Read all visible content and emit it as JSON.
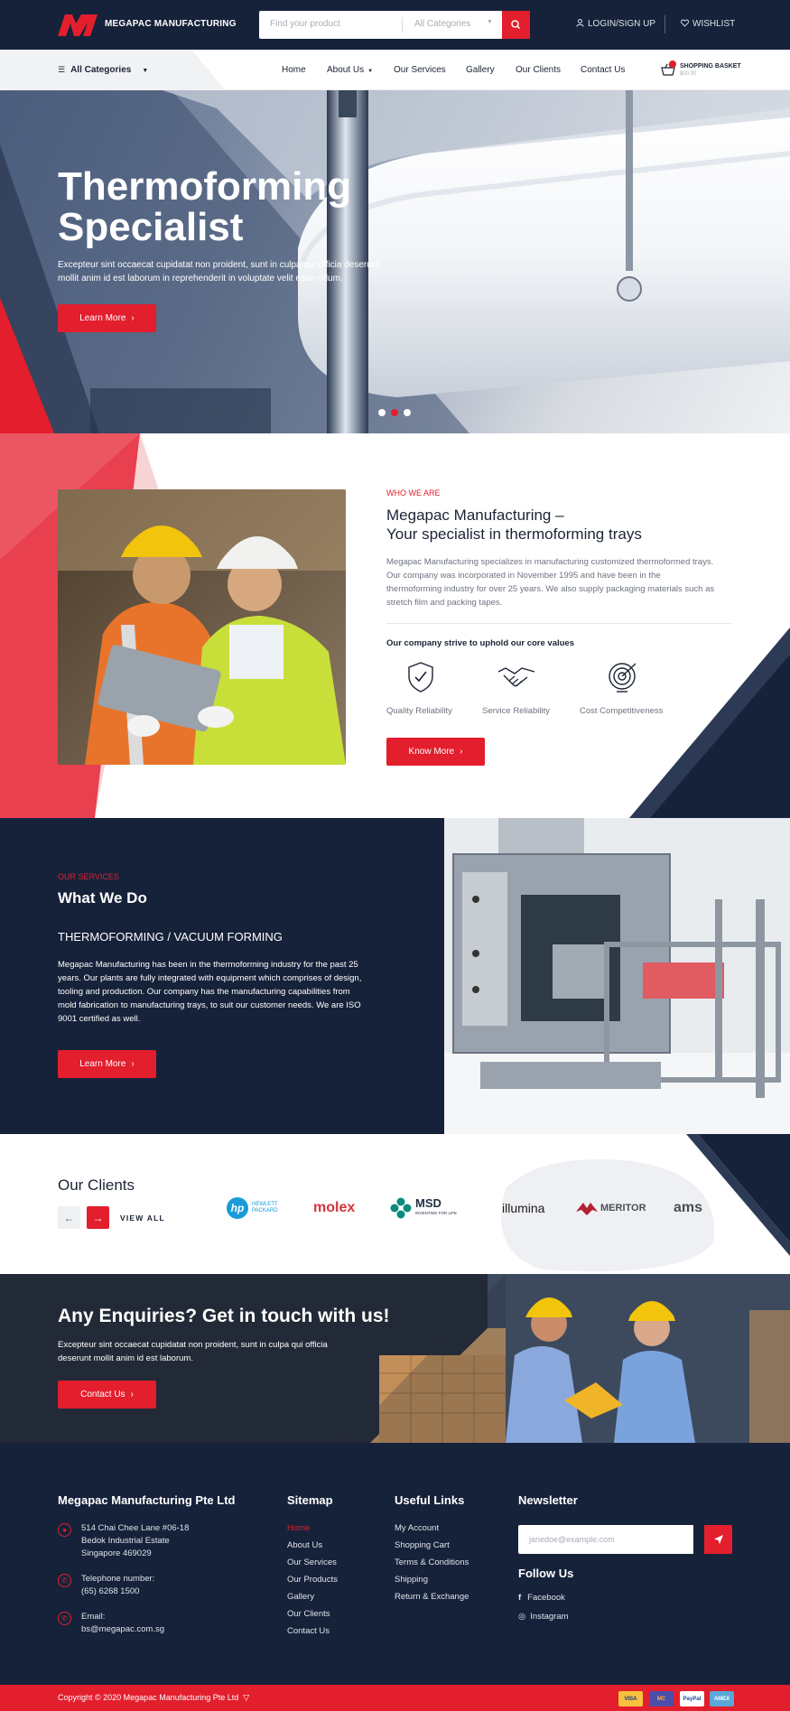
{
  "brand": {
    "name": "MEGAPAC MANUFACTURING"
  },
  "search": {
    "placeholder": "Find your product",
    "category": "All Categories"
  },
  "account": {
    "login": "LOGIN/SIGN UP",
    "wishlist": "WISHLIST"
  },
  "nav": {
    "all_categories": "All Categories",
    "items": [
      "Home",
      "About Us",
      "Our Services",
      "Gallery",
      "Our Clients",
      "Contact Us"
    ],
    "basket_title": "SHOPPING BASKET",
    "basket_amount": "$00.00"
  },
  "hero": {
    "title_line1": "Thermoforming",
    "title_line2": "Specialist",
    "text": "Excepteur sint occaecat cupidatat non proident, sunt in culpa qui officia deserunt mollit anim id est laborum in reprehenderit in voluptate velit esse cillum.",
    "button": "Learn More",
    "slides": 3,
    "active_slide": 2
  },
  "about": {
    "label": "WHO WE ARE",
    "title_line1": "Megapac Manufacturing –",
    "title_line2": "Your specialist in thermoforming trays",
    "text": "Megapac Manufacturing specializes in manufacturing customized thermoformed trays. Our company was incorporated in November 1995 and have been in the thermoforming industry for over 25 years. We also supply packaging materials such as stretch film and packing tapes.",
    "values_title": "Our company strive to uphold our core values",
    "values": [
      {
        "label": "Quality Reliability",
        "icon": "shield-check-icon"
      },
      {
        "label": "Service Reliability",
        "icon": "handshake-icon"
      },
      {
        "label": "Cost Competitiveness",
        "icon": "target-icon"
      }
    ],
    "button": "Know More"
  },
  "services": {
    "label": "OUR SERVICES",
    "title": "What We Do",
    "subtitle": "THERMOFORMING / VACUUM FORMING",
    "text": "Megapac Manufacturing has been in the thermoforming industry for the past 25 years. Our plants are fully integrated with equipment which comprises of design, tooling and production. Our company has the manufacturing capabilities from mold fabrication to manufacturing trays, to suit our customer needs. We are ISO 9001 certified as well.",
    "button": "Learn More"
  },
  "clients": {
    "title": "Our Clients",
    "view_all": "VIEW ALL",
    "logos": {
      "hp": "hp",
      "hp_line1": "HEWLETT",
      "hp_line2": "PACKARD",
      "molex": "molex",
      "msd": "MSD",
      "msd_tag": "INVENTING FOR LIFE",
      "illumina": "illumina",
      "meritor": "MERITOR",
      "ams": "ams"
    }
  },
  "enquiry": {
    "title": "Any Enquiries? Get in touch with us!",
    "text": "Excepteur sint occaecat cupidatat non proident, sunt in culpa qui officia deserunt mollit anim id est laborum.",
    "button": "Contact Us"
  },
  "footer": {
    "company": "Megapac Manufacturing Pte Ltd",
    "address_line1": "514 Chai Chee Lane #06-18",
    "address_line2": "Bedok Industrial Estate",
    "address_line3": "Singapore 469029",
    "phone_label": "Telephone number:",
    "phone": "(65) 6268 1500",
    "email_label": "Email:",
    "email": "bs@megapac.com.sg",
    "sitemap_title": "Sitemap",
    "sitemap": [
      "Home",
      "About Us",
      "Our Services",
      "Our Products",
      "Gallery",
      "Our Clients",
      "Contact Us"
    ],
    "useful_title": "Useful Links",
    "useful": [
      "My Account",
      "Shopping Cart",
      "Terms & Conditions",
      "Shipping",
      "Return & Exchange"
    ],
    "newsletter_title": "Newsletter",
    "newsletter_placeholder": "janedoe@example.com",
    "follow_title": "Follow Us",
    "social": [
      "Facebook",
      "Instagram"
    ]
  },
  "bottom": {
    "copyright": "Copyright © 2020 Megapac Manufacturing Pte Ltd",
    "cards": [
      "VISA",
      "MC",
      "PayPal",
      "AMEX"
    ]
  },
  "colors": {
    "accent": "#e31e2d",
    "navy": "#16223a",
    "text": "#1b2334"
  }
}
